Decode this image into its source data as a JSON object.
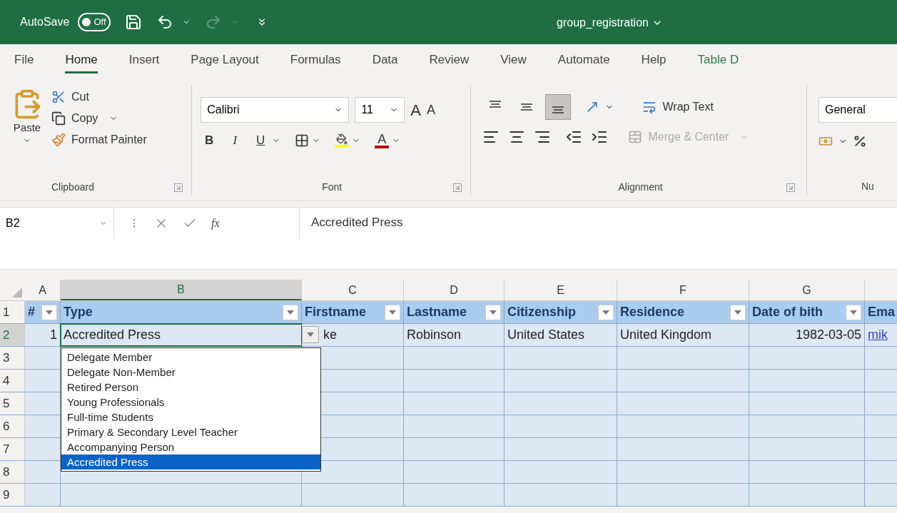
{
  "title_bar": {
    "autosave": {
      "label": "AutoSave",
      "on": false,
      "state": "Off"
    },
    "redo_disabled": true,
    "document_title": "group_registration"
  },
  "ribbon_tabs": [
    {
      "label": "File",
      "selected": false,
      "kind": "standard"
    },
    {
      "label": "Home",
      "selected": true,
      "kind": "standard"
    },
    {
      "label": "Insert",
      "selected": false,
      "kind": "standard"
    },
    {
      "label": "Page Layout",
      "selected": false,
      "kind": "standard"
    },
    {
      "label": "Formulas",
      "selected": false,
      "kind": "standard"
    },
    {
      "label": "Data",
      "selected": false,
      "kind": "standard"
    },
    {
      "label": "Review",
      "selected": false,
      "kind": "standard"
    },
    {
      "label": "View",
      "selected": false,
      "kind": "standard"
    },
    {
      "label": "Automate",
      "selected": false,
      "kind": "standard"
    },
    {
      "label": "Help",
      "selected": false,
      "kind": "standard"
    },
    {
      "label": "Table D",
      "selected": false,
      "kind": "contextual"
    }
  ],
  "ribbon": {
    "clipboard": {
      "paste": "Paste",
      "cut": "Cut",
      "copy": "Copy",
      "format_painter": "Format Painter",
      "group_label": "Clipboard"
    },
    "font": {
      "font_name": "Calibri",
      "font_size": "11",
      "grow": "A",
      "shrink": "A",
      "bold": "B",
      "italic": "I",
      "underline": "U",
      "font_color": "A",
      "group_label": "Font"
    },
    "alignment": {
      "vertical_align": [
        {
          "selected": false
        },
        {
          "selected": false
        },
        {
          "selected": true
        }
      ],
      "wrap_text": "Wrap Text",
      "merge": {
        "label": "Merge & Center",
        "disabled": true
      },
      "group_label": "Alignment"
    },
    "number": {
      "format": "General",
      "group_label": "Nu"
    }
  },
  "formula_bar": {
    "name_box": "B2",
    "function_label": "fx",
    "formula": "Accredited Press"
  },
  "sheet": {
    "columns": [
      {
        "letter": "A",
        "selected": false
      },
      {
        "letter": "B",
        "selected": true
      },
      {
        "letter": "C",
        "selected": false
      },
      {
        "letter": "D",
        "selected": false
      },
      {
        "letter": "E",
        "selected": false
      },
      {
        "letter": "F",
        "selected": false
      },
      {
        "letter": "G",
        "selected": false
      }
    ],
    "rows": [
      {
        "number": "1",
        "selected": false
      },
      {
        "number": "2",
        "selected": true
      },
      {
        "number": "3",
        "selected": false
      },
      {
        "number": "4",
        "selected": false
      },
      {
        "number": "5",
        "selected": false
      },
      {
        "number": "6",
        "selected": false
      },
      {
        "number": "7",
        "selected": false
      },
      {
        "number": "8",
        "selected": false
      },
      {
        "number": "9",
        "selected": false
      }
    ],
    "table_header": [
      "#",
      "Type",
      "Firstname",
      "Lastname",
      "Citizenship",
      "Residence",
      "Date of bith",
      "Ema"
    ],
    "data_row": [
      "1",
      "Accredited Press",
      "ke",
      "Robinson",
      "United States",
      "United Kingdom",
      "1982-03-05",
      "mik"
    ],
    "dropdown": [
      {
        "label": "Delegate Member",
        "selected": false
      },
      {
        "label": "Delegate Non-Member",
        "selected": false
      },
      {
        "label": "Retired Person",
        "selected": false
      },
      {
        "label": "Young Professionals",
        "selected": false
      },
      {
        "label": "Full-time Students",
        "selected": false
      },
      {
        "label": "Primary & Secondary Level Teacher",
        "selected": false
      },
      {
        "label": "Accompanying Person",
        "selected": false
      },
      {
        "label": "Accredited Press",
        "selected": true
      }
    ]
  }
}
